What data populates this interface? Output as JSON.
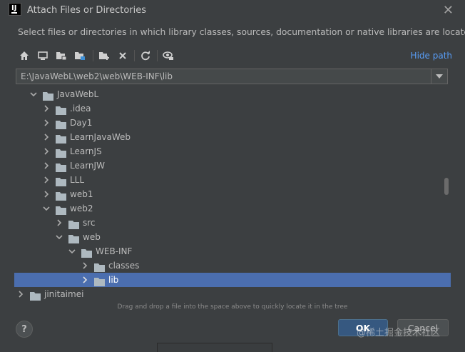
{
  "dialog": {
    "title": "Attach Files or Directories",
    "description": "Select files or directories in which library classes, sources, documentation or native libraries are located"
  },
  "toolbar": {
    "hide_path_label": "Hide path",
    "icons": [
      "home-icon",
      "desktop-icon",
      "project-folder-icon",
      "module-folder-icon",
      "new-folder-icon",
      "delete-icon",
      "refresh-icon",
      "show-hidden-icon"
    ]
  },
  "path_field": {
    "value": "E:\\JavaWebL\\web2\\web\\WEB-INF\\lib"
  },
  "tree": {
    "nodes": [
      {
        "label": "JavaWebL",
        "depth": 0,
        "expanded": true
      },
      {
        "label": ".idea",
        "depth": 1,
        "expanded": false
      },
      {
        "label": "Day1",
        "depth": 1,
        "expanded": false
      },
      {
        "label": "LearnJavaWeb",
        "depth": 1,
        "expanded": false
      },
      {
        "label": "LearnJS",
        "depth": 1,
        "expanded": false
      },
      {
        "label": "LearnJW",
        "depth": 1,
        "expanded": false
      },
      {
        "label": "LLL",
        "depth": 1,
        "expanded": false
      },
      {
        "label": "web1",
        "depth": 1,
        "expanded": false
      },
      {
        "label": "web2",
        "depth": 1,
        "expanded": true
      },
      {
        "label": "src",
        "depth": 2,
        "expanded": false
      },
      {
        "label": "web",
        "depth": 2,
        "expanded": true
      },
      {
        "label": "WEB-INF",
        "depth": 3,
        "expanded": true
      },
      {
        "label": "classes",
        "depth": 4,
        "expanded": false
      },
      {
        "label": "lib",
        "depth": 4,
        "expanded": false,
        "selected": true
      },
      {
        "label": "jinitaimei",
        "depth": -1,
        "expanded": false
      }
    ]
  },
  "hint": "Drag and drop a file into the space above to quickly locate it in the tree",
  "buttons": {
    "help": "?",
    "ok": "OK",
    "cancel": "Cancel"
  },
  "watermark": "@稀土掘金技术社区",
  "colors": {
    "background": "#3c3f41",
    "selection": "#4b6eaf",
    "link": "#589df6",
    "default_button": "#365880",
    "folder": "#aeb9c0"
  }
}
